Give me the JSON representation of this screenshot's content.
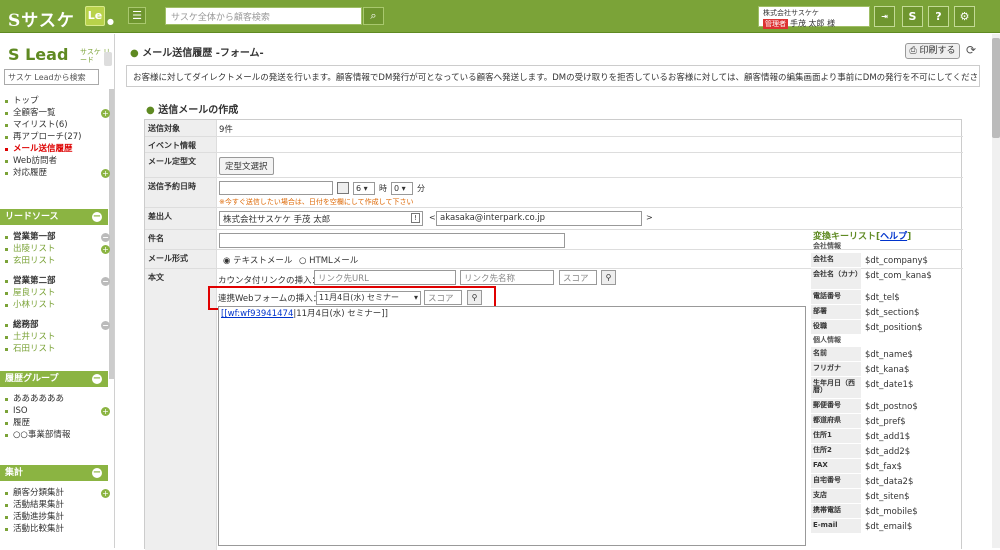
{
  "topbar": {
    "logo": "Sサスケ",
    "le_badge": "Le",
    "search_placeholder": "サスケ全体から顧客検索",
    "user_company": "株式会社サスケケ",
    "user_role": "管理者",
    "user_name": "手茂 太郎 様",
    "logout_label": "Logout"
  },
  "sidebar": {
    "logo": "S Lead",
    "logo_sub": "サスケ リード",
    "search_placeholder": "サスケ Leadから検索",
    "nav": [
      "トップ",
      "全顧客一覧",
      "マイリスト(6)",
      "再アプローチ(27)",
      "メール送信履歴",
      "Web訪問者",
      "対応履歴"
    ],
    "lead_source_title": "リードソース",
    "lead_source": [
      {
        "label": "営業第一部",
        "type": "hdr"
      },
      {
        "label": "出陵リスト",
        "type": "sub"
      },
      {
        "label": "玄田リスト",
        "type": "sub"
      },
      {
        "label": "営業第二部",
        "type": "hdr"
      },
      {
        "label": "屋良リスト",
        "type": "sub"
      },
      {
        "label": "小林リスト",
        "type": "sub"
      },
      {
        "label": "総務部",
        "type": "hdr"
      },
      {
        "label": "土井リスト",
        "type": "sub"
      },
      {
        "label": "石田リスト",
        "type": "sub"
      }
    ],
    "history_group_title": "履歴グループ",
    "history_group": [
      "ああああああ",
      "ISO",
      "履歴",
      "○○事業部情報"
    ],
    "summary_title": "集計",
    "summary": [
      "顧客分類集計",
      "活動結果集計",
      "活動進捗集計",
      "活動比較集計"
    ]
  },
  "main": {
    "page_title": "メール送信履歴 -フォーム-",
    "print_label": "印刷する",
    "info_text": "お客様に対してダイレクトメールの発送を行います。顧客情報でDM発行が可となっている顧客へ発送します。DMの受け取りを拒否しているお客様に対しては、顧客情報の編集画面より事前にDMの発行を不可にしてください。",
    "section_title": "送信メールの作成",
    "form": {
      "target_label": "送信対象",
      "target_value": "9件",
      "event_label": "イベント情報",
      "template_label": "メール定型文",
      "template_button": "定型文選択",
      "schedule_label": "送信予約日時",
      "hour": "6",
      "hour_unit": "時",
      "minute": "0",
      "minute_unit": "分",
      "schedule_note": "※今すぐ送信したい場合は、日付を空欄にして作成して下さい",
      "sender_label": "差出人",
      "sender_name": "株式会社サスケケ 手茂 太郎",
      "sender_email": "akasaka@interpark.co.jp",
      "subject_label": "件名",
      "format_label": "メール形式",
      "format_text": "テキストメール",
      "format_html": "HTMLメール",
      "body_label": "本文",
      "counter_link_label": "カウンタ付リンクの挿入：",
      "link_url_placeholder": "リンク先URL",
      "link_name_placeholder": "リンク先名称",
      "score_placeholder": "スコア",
      "webform_label": "連携Webフォームの挿入：",
      "webform_selected": "11月4日(水) セミナー",
      "webform_score_placeholder": "スコア",
      "body_code": "[[wf:wf93941474",
      "body_rest": "|11月4日(水) セミナー]]"
    }
  },
  "keys": {
    "title": "変換キーリスト",
    "help_label": "ヘルプ",
    "company_category": "会社情報",
    "company_keys": [
      {
        "label": "会社名",
        "value": "$dt_company$"
      },
      {
        "label": "会社名（カナ）",
        "value": "$dt_com_kana$"
      },
      {
        "label": "電話番号",
        "value": "$dt_tel$"
      },
      {
        "label": "部署",
        "value": "$dt_section$"
      },
      {
        "label": "役職",
        "value": "$dt_position$"
      }
    ],
    "personal_category": "個人情報",
    "personal_keys": [
      {
        "label": "名前",
        "value": "$dt_name$"
      },
      {
        "label": "フリガナ",
        "value": "$dt_kana$"
      },
      {
        "label": "生年月日（西暦）",
        "value": "$dt_date1$"
      },
      {
        "label": "郵便番号",
        "value": "$dt_postno$"
      },
      {
        "label": "都道府県",
        "value": "$dt_pref$"
      },
      {
        "label": "住所1",
        "value": "$dt_add1$"
      },
      {
        "label": "住所2",
        "value": "$dt_add2$"
      },
      {
        "label": "FAX",
        "value": "$dt_fax$"
      },
      {
        "label": "自宅番号",
        "value": "$dt_data2$"
      },
      {
        "label": "支店",
        "value": "$dt_siten$"
      },
      {
        "label": "携帯電話",
        "value": "$dt_mobile$"
      },
      {
        "label": "E-mail",
        "value": "$dt_email$"
      }
    ]
  },
  "colors": {
    "brand": "#7ba338",
    "highlight": "#e00000",
    "active_nav": "#dd0000"
  }
}
